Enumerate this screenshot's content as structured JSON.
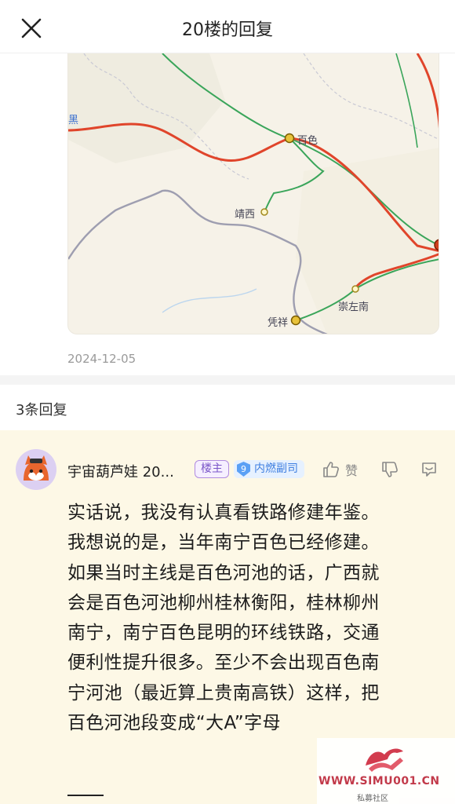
{
  "header": {
    "title": "20楼的回复",
    "close_icon": "close-icon"
  },
  "map": {
    "labels": {
      "baise": "百色",
      "jingxi": "靖西",
      "chongzuonan": "崇左南",
      "pingxiang": "凭祥",
      "edge_label": "黑"
    },
    "colors": {
      "railway_major": "#e0452b",
      "railway_minor": "#3aa55a",
      "border": "#9e9eb0",
      "station": "#e8c23a"
    }
  },
  "post": {
    "date": "2024-12-05"
  },
  "replies": {
    "count_label": "3条回复"
  },
  "reply": {
    "username": "宇宙葫芦娃 20...",
    "badge_owner": "楼主",
    "level_number": "9",
    "level_title": "内燃副司",
    "like_label": "赞",
    "text_lines": [
      "实话说，我没有认真看铁路修建年鉴。",
      "我想说的是，当年南宁百色已经修建。",
      "如果当时主线是百色河池的话，广西就",
      "会是百色河池柳州桂林衡阳，桂林柳州",
      "南宁，南宁百色昆明的环线铁路，交通",
      "便利性提升很多。至少不会出现百色南",
      "宁河池（最近算上贵南高铁）这样，把",
      "百色河池段变成“大A”字母"
    ]
  },
  "watermark": {
    "site": "WWW.SIMU001.CN",
    "subtitle": "私募社区"
  }
}
